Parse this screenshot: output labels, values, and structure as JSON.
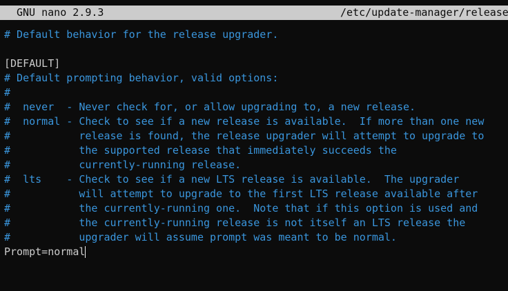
{
  "title_bar": {
    "app_name": "GNU nano 2.9.3",
    "file_path": "/etc/update-manager/release"
  },
  "colors": {
    "background": "#0c0c0c",
    "title_bar_bg": "#cccccc",
    "comment": "#3a96dd",
    "text": "#cccccc"
  },
  "editor": {
    "lines": [
      {
        "text": "# Default behavior for the release upgrader.",
        "kind": "comment"
      },
      {
        "text": "",
        "kind": "plain"
      },
      {
        "text": "[DEFAULT]",
        "kind": "plain"
      },
      {
        "text": "# Default prompting behavior, valid options:",
        "kind": "comment"
      },
      {
        "text": "#",
        "kind": "comment"
      },
      {
        "text": "#  never  - Never check for, or allow upgrading to, a new release.",
        "kind": "comment"
      },
      {
        "text": "#  normal - Check to see if a new release is available.  If more than one new",
        "kind": "comment"
      },
      {
        "text": "#           release is found, the release upgrader will attempt to upgrade to",
        "kind": "comment"
      },
      {
        "text": "#           the supported release that immediately succeeds the",
        "kind": "comment"
      },
      {
        "text": "#           currently-running release.",
        "kind": "comment"
      },
      {
        "text": "#  lts    - Check to see if a new LTS release is available.  The upgrader",
        "kind": "comment"
      },
      {
        "text": "#           will attempt to upgrade to the first LTS release available after",
        "kind": "comment"
      },
      {
        "text": "#           the currently-running one.  Note that if this option is used and",
        "kind": "comment"
      },
      {
        "text": "#           the currently-running release is not itself an LTS release the",
        "kind": "comment"
      },
      {
        "text": "#           upgrader will assume prompt was meant to be normal.",
        "kind": "comment"
      },
      {
        "text": "Prompt=normal",
        "kind": "plain"
      }
    ]
  }
}
